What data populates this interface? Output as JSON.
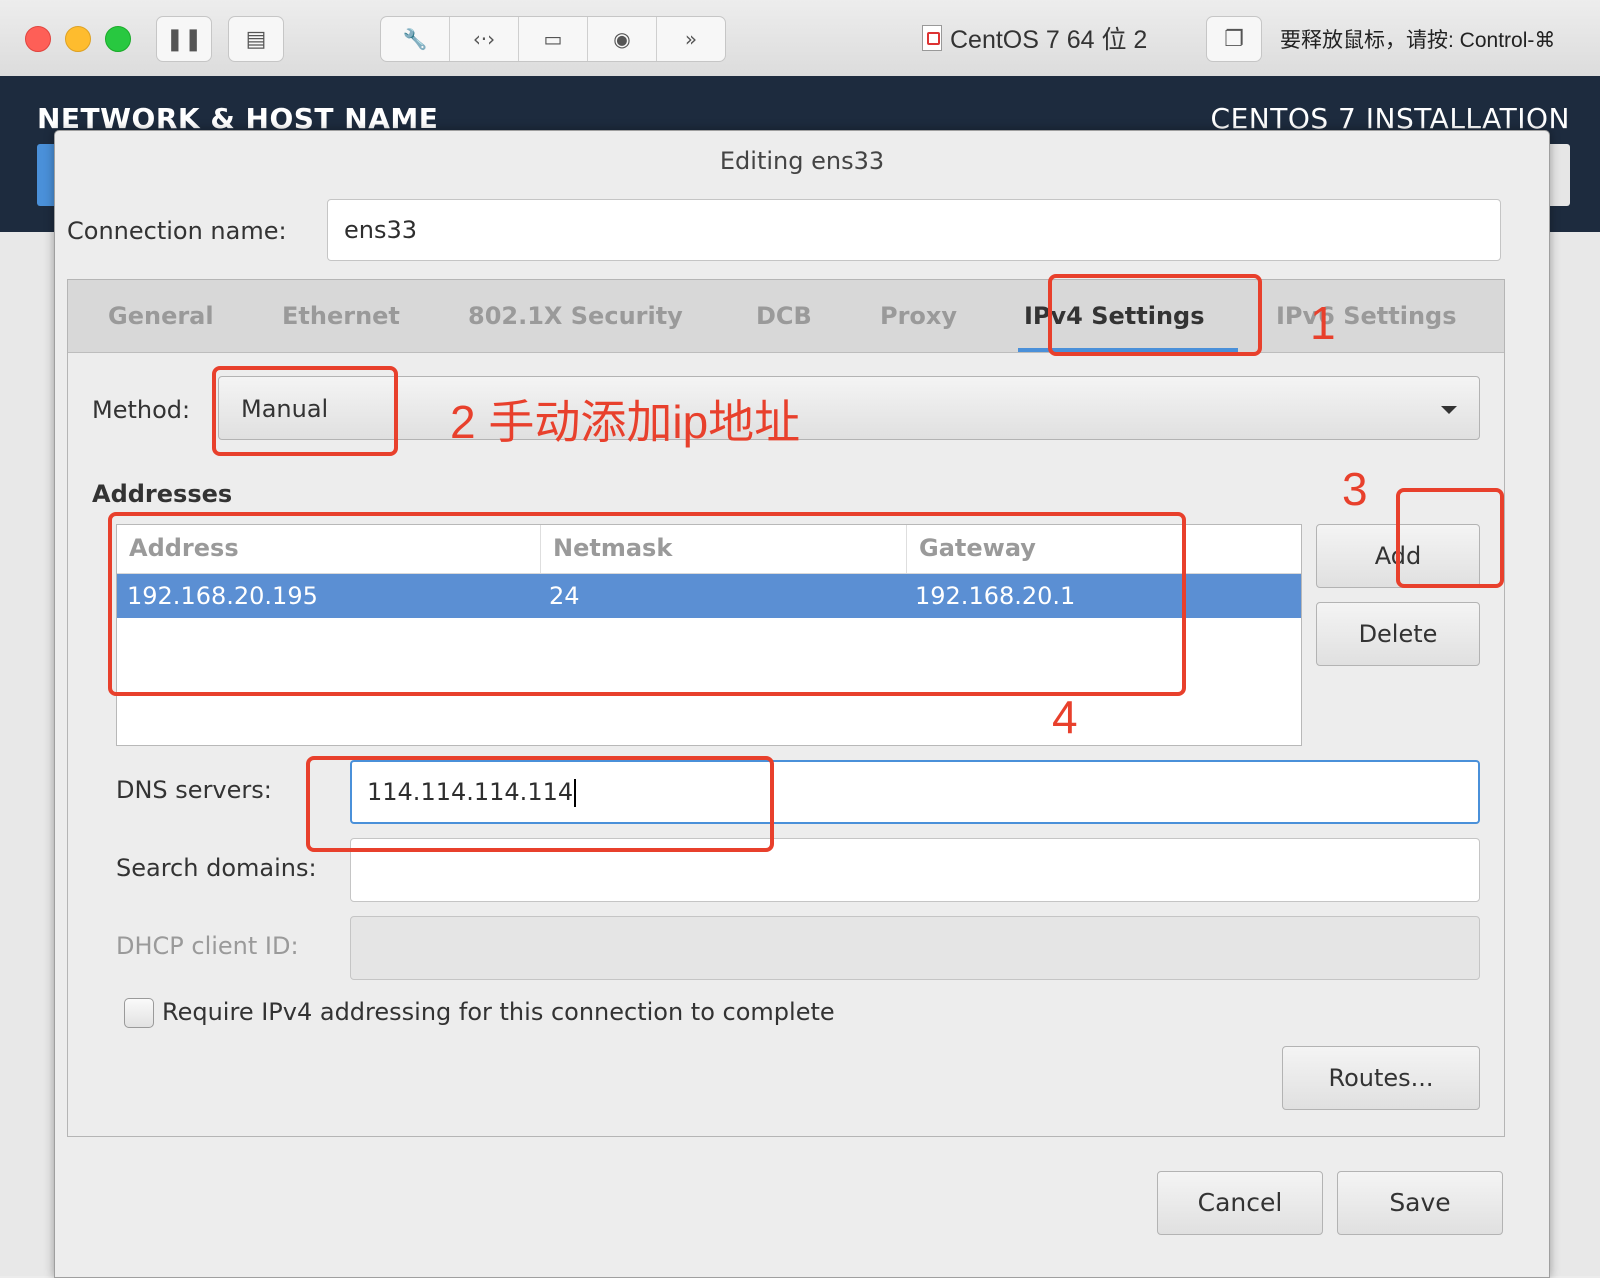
{
  "vm": {
    "title": "CentOS 7 64 位 2",
    "release_hint": "要释放鼠标，请按: Control-⌘"
  },
  "installer": {
    "page_title": "NETWORK & HOST NAME",
    "product_title": "CENTOS 7 INSTALLATION"
  },
  "dialog": {
    "title": "Editing ens33",
    "connection_name_label": "Connection name:",
    "connection_name_value": "ens33",
    "tabs": [
      {
        "label": "General"
      },
      {
        "label": "Ethernet"
      },
      {
        "label": "802.1X Security"
      },
      {
        "label": "DCB"
      },
      {
        "label": "Proxy"
      },
      {
        "label": "IPv4 Settings"
      },
      {
        "label": "IPv6 Settings"
      }
    ],
    "active_tab": "IPv4 Settings",
    "method_label": "Method:",
    "method_value": "Manual",
    "addresses_heading": "Addresses",
    "address_columns": [
      "Address",
      "Netmask",
      "Gateway"
    ],
    "address_rows": [
      {
        "address": "192.168.20.195",
        "netmask": "24",
        "gateway": "192.168.20.1"
      }
    ],
    "add_button": "Add",
    "delete_button": "Delete",
    "dns_label": "DNS servers:",
    "dns_value": "114.114.114.114",
    "search_label": "Search domains:",
    "search_value": "",
    "dhcp_label": "DHCP client ID:",
    "dhcp_value": "",
    "require_label": "Require IPv4 addressing for this connection to complete",
    "require_checked": false,
    "routes_button": "Routes...",
    "cancel_button": "Cancel",
    "save_button": "Save"
  },
  "annotations": {
    "step1": "1",
    "step2": "2 手动添加ip地址",
    "step3": "3",
    "step4": "4",
    "color": "#e8402c"
  },
  "colors": {
    "selection": "#5b8fd3",
    "focus": "#4a90d9",
    "header_bg": "#1d2b3e"
  }
}
